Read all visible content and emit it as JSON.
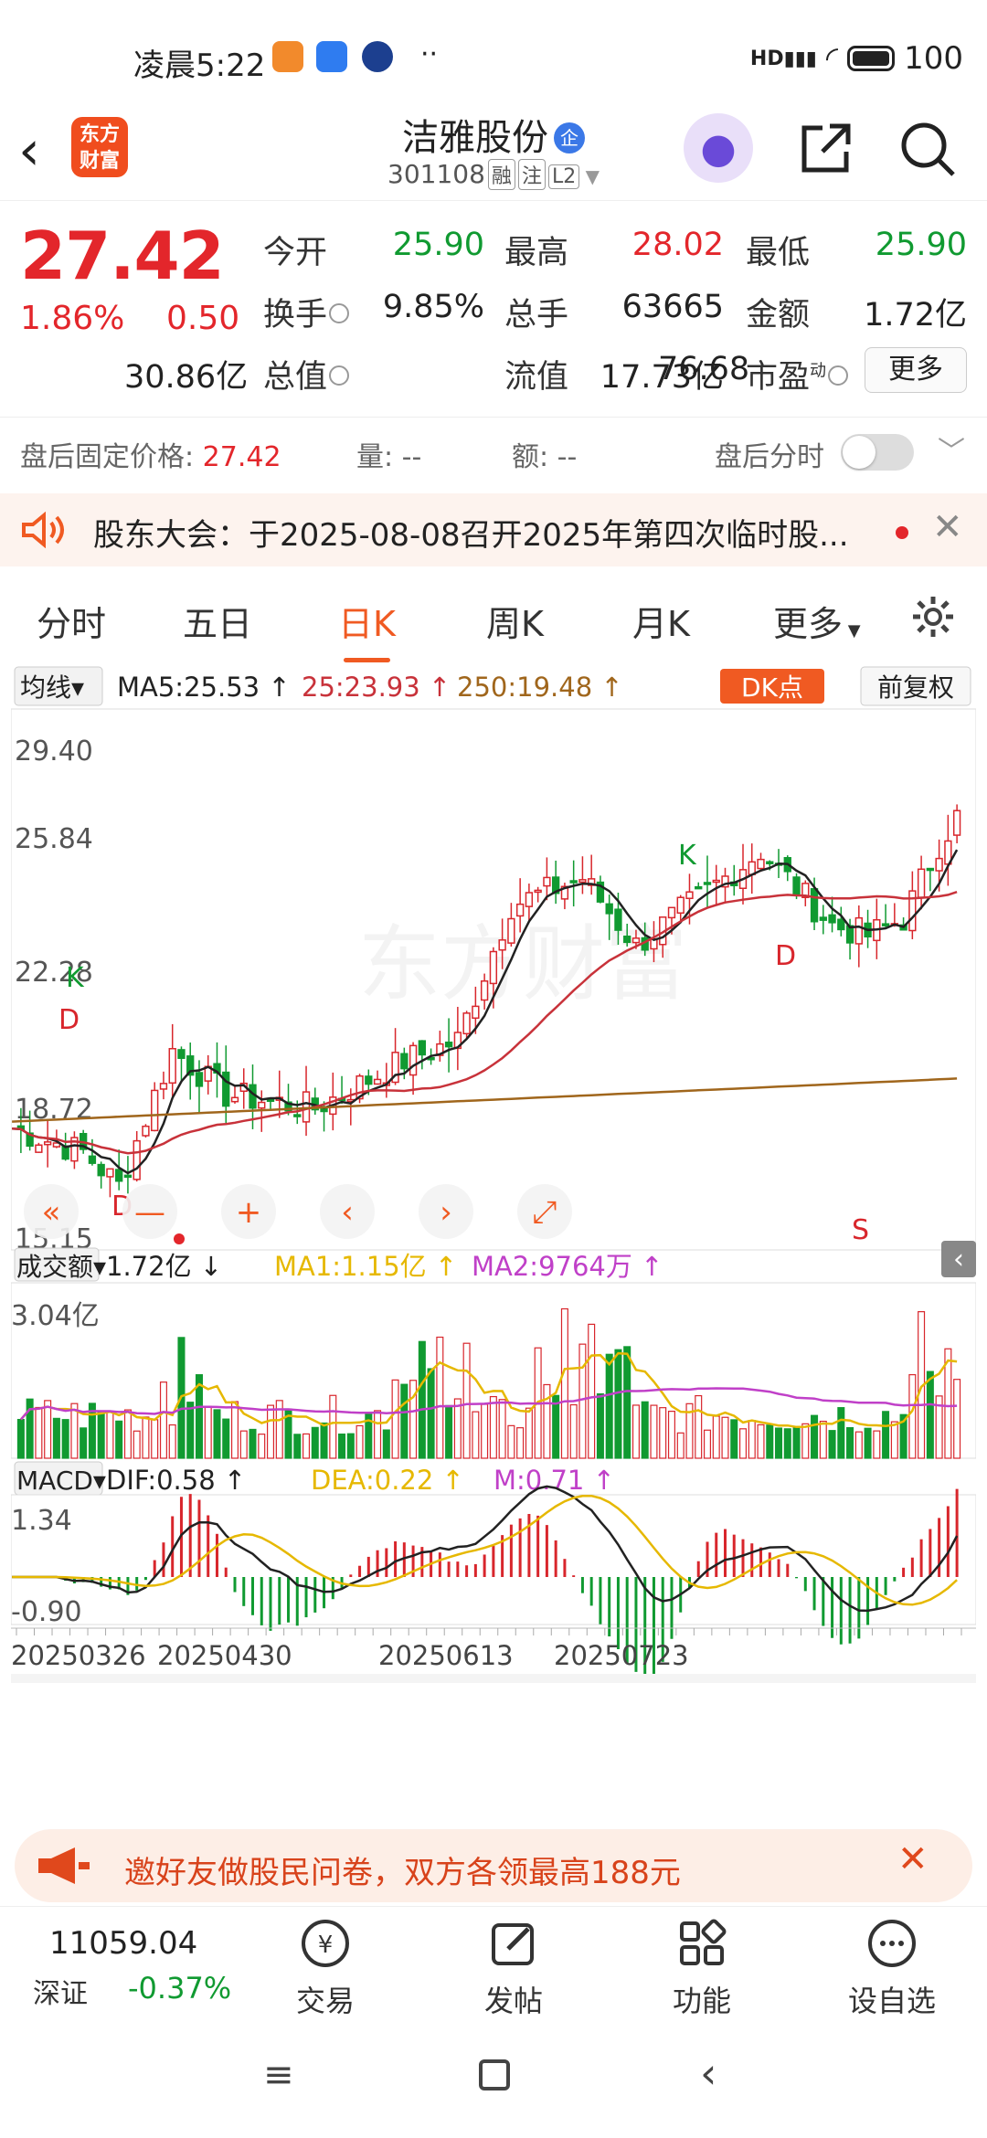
{
  "status_bar": {
    "time": "凌晨5:22",
    "signal_label": "HD",
    "battery": "100"
  },
  "header": {
    "logo_line1": "东方",
    "logo_line2": "财富",
    "stock_name": "洁雅股份",
    "name_badge": "企",
    "stock_code": "301108",
    "tags": [
      "融",
      "注",
      "L2"
    ]
  },
  "quote": {
    "price": "27.42",
    "change_pct": "1.86%",
    "change": "0.50",
    "rows": [
      [
        {
          "label": "今开",
          "value": "25.90",
          "color": "green"
        },
        {
          "label": "最高",
          "value": "28.02",
          "color": "red"
        },
        {
          "label": "最低",
          "value": "25.90",
          "color": "green"
        }
      ],
      [
        {
          "label": "换手",
          "value": "9.85%",
          "color": "black"
        },
        {
          "label": "总手",
          "value": "63665",
          "color": "black"
        },
        {
          "label": "金额",
          "value": "1.72亿",
          "color": "black"
        }
      ],
      [
        {
          "label": "总值",
          "value": "30.86亿",
          "color": "black"
        },
        {
          "label": "流值",
          "value": "17.73亿",
          "color": "black"
        },
        {
          "label": "市盈",
          "value": "76.68",
          "color": "black"
        }
      ]
    ],
    "pe_superscript": "动",
    "more_label": "更多"
  },
  "after_hours": {
    "label": "盘后固定价格:",
    "price": "27.42",
    "volume_label": "量:",
    "volume": "--",
    "amount_label": "额:",
    "amount": "--",
    "intraday_label": "盘后分时"
  },
  "notice": {
    "text": "股东大会：于2025-08-08召开2025年第四次临时股..."
  },
  "tabs": [
    {
      "label": "分时",
      "active": false
    },
    {
      "label": "五日",
      "active": false
    },
    {
      "label": "日K",
      "active": true
    },
    {
      "label": "周K",
      "active": false
    },
    {
      "label": "月K",
      "active": false
    },
    {
      "label": "更多",
      "active": false
    }
  ],
  "kline": {
    "ma_selector": "均线",
    "ma5": "MA5:25.53",
    "ma25": "25:23.93",
    "ma250": "250:19.48",
    "dk_button": "DK点",
    "adjust_button": "前复权",
    "y_labels": [
      "29.40",
      "25.84",
      "22.28",
      "18.72",
      "15.15"
    ],
    "markers": [
      "K",
      "D",
      "D",
      "K",
      "D",
      "S"
    ],
    "volume_selector": "成交额",
    "volume_value": "1.72亿",
    "vol_ma1": "MA1:1.15亿",
    "vol_ma2": "MA2:9764万",
    "vol_max_label": "3.04亿",
    "macd_selector": "MACD",
    "dif": "DIF:0.58",
    "dea": "DEA:0.22",
    "m": "M:0.71",
    "macd_top": "1.34",
    "macd_bottom": "-0.90",
    "dates": [
      "20250326",
      "20250430",
      "20250613",
      "20250723"
    ],
    "colors": {
      "up": "#d8262c",
      "down": "#109a31",
      "ma5": "#222222",
      "ma25": "#c8323a",
      "ma250": "#a0661c",
      "vol_ma1": "#e6b800",
      "vol_ma2": "#c040c8",
      "dea": "#e6b800"
    }
  },
  "banner": {
    "text": "邀好友做股民问卷，双方各领最高188元"
  },
  "bottom_nav": {
    "index_value": "11059.04",
    "index_name": "深证",
    "index_change": "-0.37%",
    "items": [
      {
        "label": "交易",
        "icon": "trade-icon"
      },
      {
        "label": "发帖",
        "icon": "post-icon"
      },
      {
        "label": "功能",
        "icon": "function-icon"
      },
      {
        "label": "设自选",
        "icon": "add-watchlist-icon"
      }
    ]
  }
}
